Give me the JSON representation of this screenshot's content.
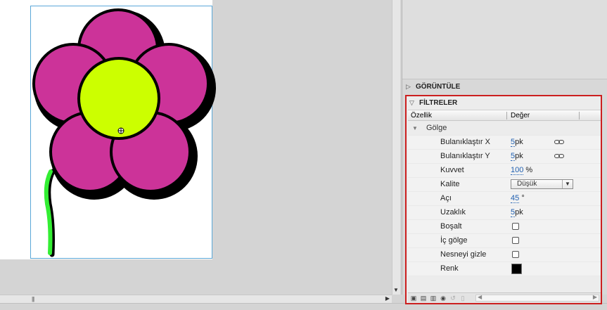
{
  "panel": {
    "display_section": "GÖRÜNTÜLE",
    "filters_section": "FİLTRELER",
    "columns": {
      "property": "Özellik",
      "value": "Değer"
    }
  },
  "filter": {
    "group_label": "Gölge",
    "blur_x": {
      "label": "Bulanıklaştır X",
      "value": "5",
      "unit": "pk"
    },
    "blur_y": {
      "label": "Bulanıklaştır Y",
      "value": "5",
      "unit": "pk"
    },
    "strength": {
      "label": "Kuvvet",
      "value": "100",
      "unit": "%"
    },
    "quality": {
      "label": "Kalite",
      "value": "Düşük"
    },
    "angle": {
      "label": "Açı",
      "value": "45",
      "unit": "°"
    },
    "distance": {
      "label": "Uzaklık",
      "value": "5",
      "unit": "pk"
    },
    "knockout": {
      "label": "Boşalt",
      "checked": false
    },
    "inner_shadow": {
      "label": "İç gölge",
      "checked": false
    },
    "hide_object": {
      "label": "Nesneyi gizle",
      "checked": false
    },
    "color": {
      "label": "Renk",
      "value": "#000000"
    }
  },
  "colors": {
    "petal": "#cc3399",
    "center": "#ccff00",
    "stem": "#33ee33",
    "highlight_border": "#cc1f1f",
    "stage_border": "#5aa7d8"
  },
  "icons": {
    "toolbar": [
      "add-filter-icon",
      "presets-icon",
      "clipboard-icon",
      "enable-toggle-icon",
      "reset-icon",
      "delete-filter-icon"
    ],
    "link": "link-icon"
  }
}
